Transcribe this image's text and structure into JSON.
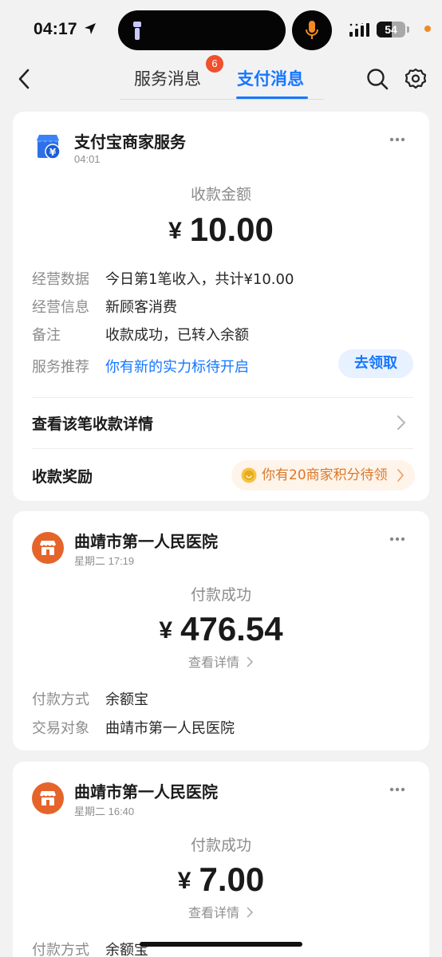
{
  "status_bar": {
    "time": "04:17",
    "battery": "54",
    "battery_level": 0.54
  },
  "nav": {
    "tab_service": "服务消息",
    "tab_service_badge": "6",
    "tab_pay": "支付消息"
  },
  "card1": {
    "merchant": "支付宝商家服务",
    "time": "04:01",
    "amount_label": "收款金额",
    "currency": "¥",
    "amount": "10.00",
    "rows": [
      {
        "label": "经营数据",
        "value": "今日第1笔收入，共计¥10.00"
      },
      {
        "label": "经营信息",
        "value": "新顾客消费"
      },
      {
        "label": "备注",
        "value": "收款成功，已转入余额"
      },
      {
        "label": "服务推荐",
        "value": "你有新的实力标待开启"
      }
    ],
    "claim_button": "去领取",
    "detail_row": "查看该笔收款详情",
    "reward_label": "收款奖励",
    "reward_pill": "你有20商家积分待领"
  },
  "card2": {
    "merchant": "曲靖市第一人民医院",
    "time": "星期二 17:19",
    "status": "付款成功",
    "currency": "¥",
    "amount": "476.54",
    "detail_link": "查看详情",
    "rows": [
      {
        "label": "付款方式",
        "value": "余额宝"
      },
      {
        "label": "交易对象",
        "value": "曲靖市第一人民医院"
      }
    ]
  },
  "card3": {
    "merchant": "曲靖市第一人民医院",
    "time": "星期二 16:40",
    "status": "付款成功",
    "currency": "¥",
    "amount": "7.00",
    "detail_link": "查看详情",
    "rows": [
      {
        "label": "付款方式",
        "value": "余额宝"
      }
    ]
  },
  "colors": {
    "accent": "#1677ff",
    "badge": "#f0502e",
    "merchant_logo": "#e5642b",
    "reward": "#d9782b"
  },
  "icons": [
    "location-arrow-icon",
    "flashlight-icon",
    "microphone-icon",
    "signal-icon",
    "back-icon",
    "search-icon",
    "gear-icon",
    "shop-icon",
    "more-icon",
    "chevron-right-icon",
    "coin-icon"
  ]
}
